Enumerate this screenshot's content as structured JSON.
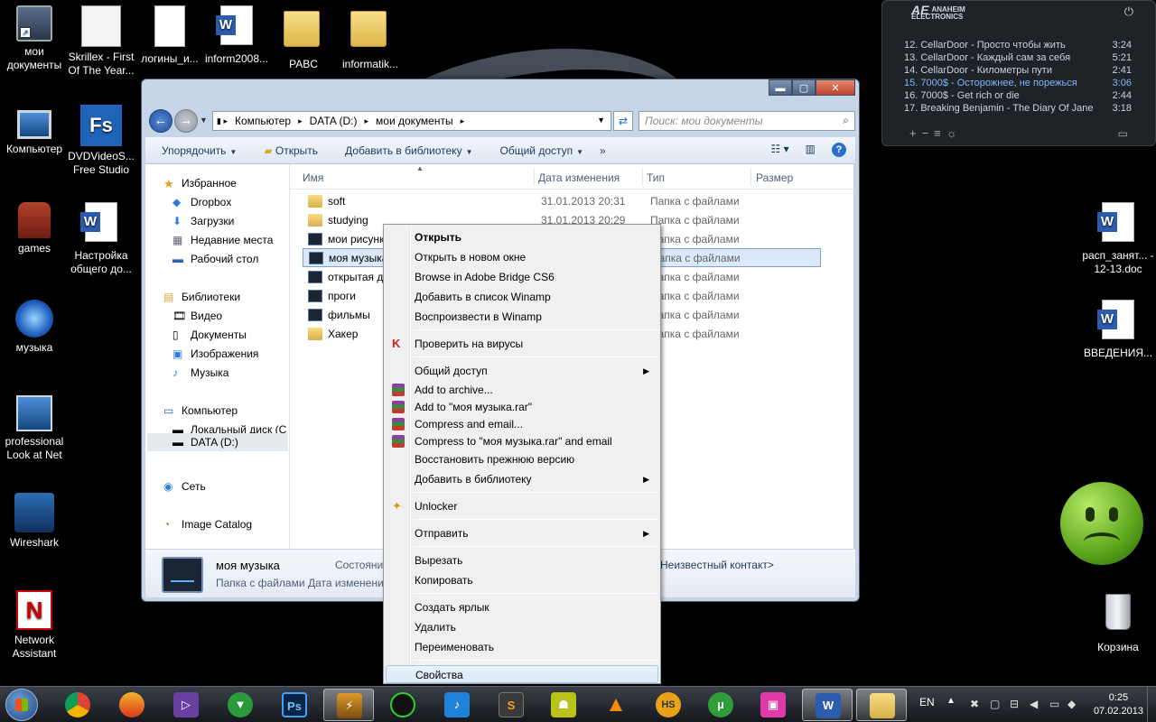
{
  "desktop": {
    "left_icons": [
      {
        "label": "мои документы",
        "icon": "folder-monitor"
      },
      {
        "label": "Skrillex - First Of The Year...",
        "icon": "image-file"
      },
      {
        "label": "логины_и...",
        "icon": "text-file"
      },
      {
        "label": "inform2008...",
        "icon": "word-doc"
      },
      {
        "label": "PABC",
        "icon": "folder"
      },
      {
        "label": "informatik...",
        "icon": "folder"
      },
      {
        "label": "Компьютер",
        "icon": "computer"
      },
      {
        "label": "DVDVideoS... Free Studio",
        "icon": "fs-app"
      },
      {
        "label": "games",
        "icon": "armchair"
      },
      {
        "label": "Настройка общего до...",
        "icon": "word-doc"
      },
      {
        "label": "музыка",
        "icon": "music-disc"
      },
      {
        "label": "professional Look at Net",
        "icon": "network-computers"
      },
      {
        "label": "Wireshark",
        "icon": "wireshark"
      },
      {
        "label": "Network Assistant",
        "icon": "network-assistant"
      }
    ],
    "right_icons": [
      {
        "label": "расп_занят... - 12-13.doc",
        "icon": "word-doc"
      },
      {
        "label": "ВВЕДЕНИЯ...",
        "icon": "word-doc"
      },
      {
        "label": "Корзина",
        "icon": "recycle-bin"
      }
    ]
  },
  "winamp": {
    "brand_line1": "ANAHEIM",
    "brand_line2": "ELECTRONICS",
    "brand_mark": "AE",
    "playlist": [
      {
        "title": "12. CellarDoor - Просто чтобы жить",
        "time": "3:24",
        "highlight": false
      },
      {
        "title": "13. CellarDoor - Каждый сам за себя",
        "time": "5:21",
        "highlight": false
      },
      {
        "title": "14. CellarDoor - Километры пути",
        "time": "2:41",
        "highlight": false
      },
      {
        "title": "15. 7000$ - Осторожнее, не порежься",
        "time": "3:06",
        "highlight": true
      },
      {
        "title": "16. 7000$ - Get rich or die",
        "time": "2:44",
        "highlight": false
      },
      {
        "title": "17. Breaking Benjamin - The Diary Of Jane",
        "time": "3:18",
        "highlight": false
      }
    ]
  },
  "explorer": {
    "breadcrumb": [
      "Компьютер",
      "DATA (D:)",
      "мои документы"
    ],
    "search_placeholder": "Поиск: мои документы",
    "toolbar": {
      "organize": "Упорядочить",
      "open": "Открыть",
      "add_library": "Добавить в библиотеку",
      "share": "Общий доступ",
      "more": "»"
    },
    "nav": {
      "favorites": "Избранное",
      "fav_items": [
        "Dropbox",
        "Загрузки",
        "Недавние места",
        "Рабочий стол"
      ],
      "libraries": "Библиотеки",
      "lib_items": [
        "Видео",
        "Документы",
        "Изображения",
        "Музыка"
      ],
      "computer": "Компьютер",
      "drives": [
        "Локальный диск (C",
        "DATA (D:)"
      ],
      "network": "Сеть",
      "image_catalog": "Image Catalog"
    },
    "columns": [
      "Имя",
      "Дата изменения",
      "Тип",
      "Размер"
    ],
    "files": [
      {
        "name": "soft",
        "date": "31.01.2013 20:31",
        "type": "Папка с файлами",
        "icon": "folder"
      },
      {
        "name": "studying",
        "date": "31.01.2013 20:29",
        "type": "Папка с файлами",
        "icon": "folder"
      },
      {
        "name": "мои рисунк",
        "date": "",
        "type": "Папка с файлами",
        "icon": "dark-folder"
      },
      {
        "name": "моя музыка",
        "date": "",
        "type": "Папка с файлами",
        "icon": "dark-folder",
        "selected": true
      },
      {
        "name": "открытая дл",
        "date": "",
        "type": "Папка с файлами",
        "icon": "dark-folder"
      },
      {
        "name": "проги",
        "date": "",
        "type": "Папка с файлами",
        "icon": "dark-folder"
      },
      {
        "name": "фильмы",
        "date": "",
        "type": "Папка с файлами",
        "icon": "dark-folder"
      },
      {
        "name": "Хакер",
        "date": "",
        "type": "Папка с файлами",
        "icon": "folder"
      }
    ],
    "details": {
      "name": "моя музыка",
      "type": "Папка с файлами",
      "state": "Состояни",
      "date_label": "Дата изменени",
      "contact": "Неизвестный контакт>"
    }
  },
  "context_menu": [
    {
      "label": "Открыть",
      "bold": true
    },
    {
      "label": "Открыть в новом окне"
    },
    {
      "label": "Browse in Adobe Bridge CS6"
    },
    {
      "label": "Добавить в список Winamp"
    },
    {
      "label": "Воспроизвести в Winamp"
    },
    {
      "label": "Проверить на вирусы",
      "icon": "kaspersky"
    },
    {
      "label": "Общий доступ",
      "submenu": true
    },
    {
      "label": "Add to archive...",
      "icon": "winrar"
    },
    {
      "label": "Add to \"моя музыка.rar\"",
      "icon": "winrar"
    },
    {
      "label": "Compress and email...",
      "icon": "winrar"
    },
    {
      "label": "Compress to \"моя музыка.rar\" and email",
      "icon": "winrar"
    },
    {
      "label": "Восстановить прежнюю версию"
    },
    {
      "label": "Добавить в библиотеку",
      "submenu": true
    },
    {
      "label": "Unlocker",
      "icon": "unlocker"
    },
    {
      "label": "Отправить",
      "submenu": true
    },
    {
      "label": "Вырезать"
    },
    {
      "label": "Копировать"
    },
    {
      "label": "Создать ярлык"
    },
    {
      "label": "Удалить"
    },
    {
      "label": "Переименовать"
    },
    {
      "label": "Свойства",
      "hover": true
    }
  ],
  "taskbar": {
    "apps": [
      "chrome",
      "mail-app",
      "visual-studio",
      "navigator",
      "photoshop",
      "winamp",
      "razer",
      "music-player",
      "sublime",
      "game-app",
      "vlc",
      "hotspot-shield",
      "utorrent",
      "winamp-media",
      "word",
      "explorer"
    ],
    "ps_label": "Ps",
    "s_label": "S",
    "hs_label": "HS",
    "word_label": "W",
    "lang": "EN",
    "time": "0:25",
    "date": "07.02.2013"
  }
}
